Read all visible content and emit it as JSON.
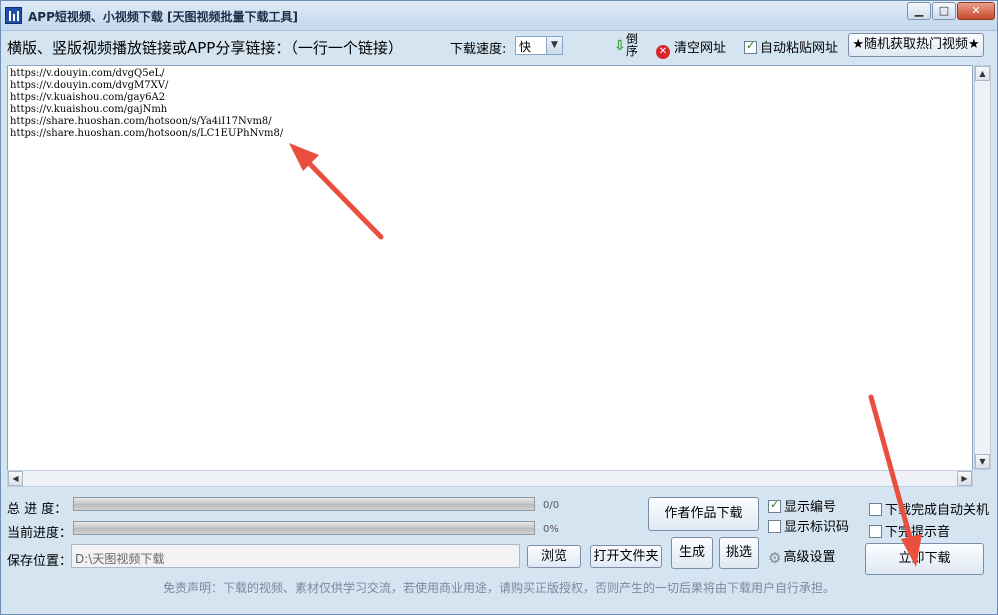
{
  "window": {
    "title": "APP短视频、小视频下载 [天图视频批量下载工具]",
    "minimize_glyph": "▁",
    "maximize_glyph": "□",
    "close_glyph": "✕"
  },
  "toolbar": {
    "prompt": "横版、竖版视频播放链接或APP分享链接：（一行一个链接）",
    "speed_label": "下载速度:",
    "speed_value": "快",
    "reverse_label": "倒序",
    "clear_label": "清空网址",
    "auto_paste_label": "自动粘贴网址",
    "auto_paste_checked": true,
    "hot_video_button": "★随机获取热门视频★"
  },
  "urls": [
    "https://v.douyin.com/dvgQ5eL/",
    "https://v.douyin.com/dvgM7XV/",
    "https://v.kuaishou.com/gay6A2",
    "https://v.kuaishou.com/gajNmh",
    "https://share.huoshan.com/hotsoon/s/Ya4iI17Nvm8/",
    "https://share.huoshan.com/hotsoon/s/LC1EUPhNvm8/"
  ],
  "progress": {
    "total_label": "总 进 度：",
    "total_text": "0/0",
    "total_fraction": 0,
    "current_label": "当前进度：",
    "current_text": "0%",
    "current_fraction": 0
  },
  "save": {
    "label": "保存位置：",
    "path": "D:\\天图视频下载",
    "browse_button": "浏览",
    "open_folder_button": "打开文件夹"
  },
  "actions": {
    "author_works_button": "作者作品下载",
    "generate_button": "生成",
    "pick_button": "挑选",
    "show_number_label": "显示编号",
    "show_number_checked": true,
    "show_id_label": "显示标识码",
    "show_id_checked": false,
    "advanced_settings": "高级设置",
    "auto_shutdown_label": "下载完成自动关机",
    "auto_shutdown_checked": false,
    "sound_prompt_label": "下完提示音",
    "sound_prompt_checked": false,
    "download_now_button": "立即下载"
  },
  "footer": "免责声明：下载的视频、素材仅供学习交流，若使用商业用途，请购买正版授权，否则产生的一切后果将由下载用户自行承担。",
  "colors": {
    "annotation_arrow": "#ea4f3e",
    "progress_fill": "#3fa43f",
    "close_button": "#c8482c"
  }
}
